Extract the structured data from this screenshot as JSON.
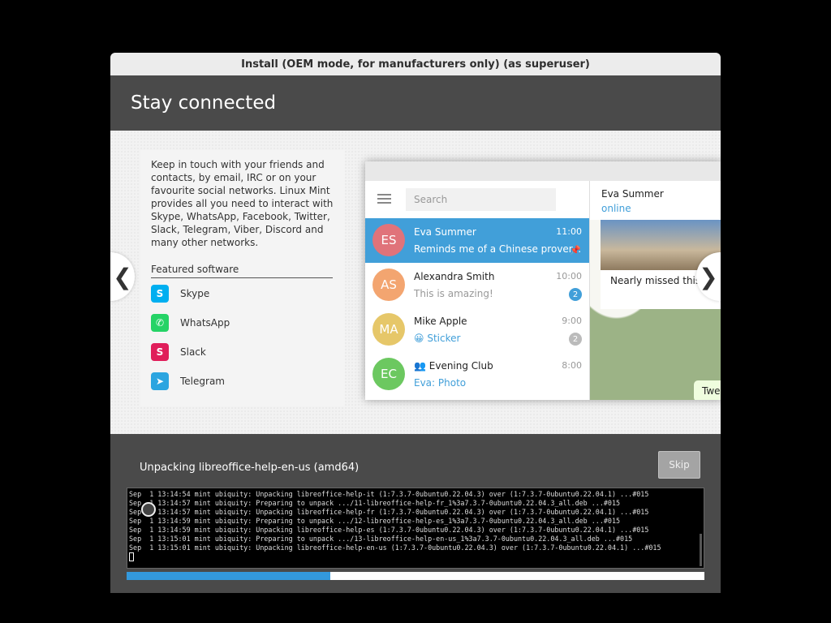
{
  "window": {
    "title": "Install (OEM mode, for manufacturers only) (as superuser)",
    "heading": "Stay connected"
  },
  "slide": {
    "description": "Keep in touch with your friends and contacts, by email, IRC or on your favourite social networks. Linux Mint provides all you need to interact with Skype, WhatsApp, Facebook, Twitter, Slack, Telegram, Viber, Discord and many other networks.",
    "featured_title": "Featured software",
    "software": [
      {
        "name": "Skype",
        "icon": "skype-icon",
        "color": "#00aff0",
        "glyph": "S"
      },
      {
        "name": "WhatsApp",
        "icon": "whatsapp-icon",
        "color": "#25d366",
        "glyph": "✆"
      },
      {
        "name": "Slack",
        "icon": "slack-icon",
        "color": "#e01e5a",
        "glyph": "S"
      },
      {
        "name": "Telegram",
        "icon": "telegram-icon",
        "color": "#2ca5e0",
        "glyph": "➤"
      }
    ],
    "prev_glyph": "❮",
    "next_glyph": "❯"
  },
  "telegram": {
    "search_placeholder": "Search",
    "chats": [
      {
        "initials": "ES",
        "name": "Eva Summer",
        "time": "11:00",
        "message": "Reminds me of a Chinese prover...",
        "badge": "📌",
        "avatar_color": "#e0737a",
        "badge_color": "transparent"
      },
      {
        "initials": "AS",
        "name": "Alexandra Smith",
        "time": "10:00",
        "message": "This is amazing!",
        "badge": "2",
        "avatar_color": "#f3a570",
        "badge_color": "#419fd9"
      },
      {
        "initials": "MA",
        "name": "Mike Apple",
        "time": "9:00",
        "message": "😀 Sticker",
        "badge": "2",
        "avatar_color": "#e6c769",
        "badge_color": "#bbbbbb"
      },
      {
        "initials": "EC",
        "name": "👥 Evening Club",
        "time": "8:00",
        "message": "Eva: Photo",
        "badge": "",
        "avatar_color": "#6cc860",
        "badge_color": "transparent"
      }
    ],
    "contact_name": "Eva Summer",
    "contact_status": "online",
    "photo_caption": "Nearly missed this s",
    "bubble_text": "Twe"
  },
  "install": {
    "status": "Unpacking libreoffice-help-en-us (amd64)",
    "skip_label": "Skip",
    "log": "Sep  1 13:14:54 mint ubiquity: Unpacking libreoffice-help-it (1:7.3.7-0ubuntu0.22.04.3) over (1:7.3.7-0ubuntu0.22.04.1) ...#015\nSep  1 13:14:57 mint ubiquity: Preparing to unpack .../11-libreoffice-help-fr_1%3a7.3.7-0ubuntu0.22.04.3_all.deb ...#015\nSep  1 13:14:57 mint ubiquity: Unpacking libreoffice-help-fr (1:7.3.7-0ubuntu0.22.04.3) over (1:7.3.7-0ubuntu0.22.04.1) ...#015\nSep  1 13:14:59 mint ubiquity: Preparing to unpack .../12-libreoffice-help-es_1%3a7.3.7-0ubuntu0.22.04.3_all.deb ...#015\nSep  1 13:14:59 mint ubiquity: Unpacking libreoffice-help-es (1:7.3.7-0ubuntu0.22.04.3) over (1:7.3.7-0ubuntu0.22.04.1) ...#015\nSep  1 13:15:01 mint ubiquity: Preparing to unpack .../13-libreoffice-help-en-us_1%3a7.3.7-0ubuntu0.22.04.3_all.deb ...#015\nSep  1 13:15:01 mint ubiquity: Unpacking libreoffice-help-en-us (1:7.3.7-0ubuntu0.22.04.3) over (1:7.3.7-0ubuntu0.22.04.1) ...#015",
    "progress": 0.353,
    "accent_color": "#3399dd"
  }
}
